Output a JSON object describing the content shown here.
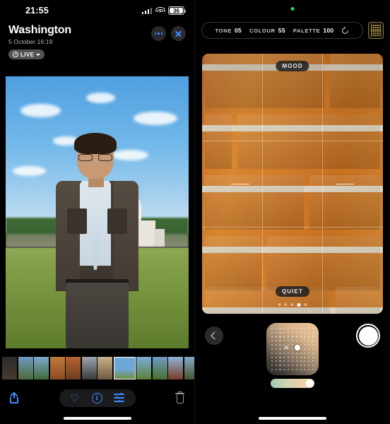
{
  "left_phone": {
    "status_bar": {
      "time": "21:55",
      "battery_level": "36",
      "signal_icon": "cellular-signal-icon",
      "wifi_icon": "wifi-icon"
    },
    "header": {
      "title": "Washington",
      "subtitle": "5 October  16:19",
      "live_badge": "LIVE",
      "more_button": "more-options",
      "close_button": "close"
    },
    "photo": {
      "description": "Man in denim jacket in front of the US Capitol"
    },
    "filmstrip": {
      "count": 14,
      "selected_index": 7
    },
    "toolbar": {
      "share": "share",
      "favourite": "favourite",
      "info": "i",
      "adjust": "adjust",
      "delete": "delete"
    }
  },
  "right_phone": {
    "params": [
      {
        "label": "TONE",
        "value": "05"
      },
      {
        "label": "COLOUR",
        "value": "55"
      },
      {
        "label": "PALETTE",
        "value": "100"
      }
    ],
    "reset_icon": "reset-icon",
    "palette_button": "palette-grid-icon",
    "viewfinder": {
      "top_tag": "MOOD",
      "bottom_tag": "QUIET",
      "page_dots": 5,
      "active_dot": 4,
      "subject": "Orange brick wall"
    },
    "controls": {
      "back": "back",
      "shutter": "shutter",
      "colour_pad": "colour-pad",
      "intensity_slider": "intensity-slider"
    }
  },
  "colors": {
    "accent_blue": "#3d8bfd",
    "brick_orange": "#cf7a2a",
    "record_green": "#2fd860",
    "palette_gold": "#c9a24a"
  }
}
